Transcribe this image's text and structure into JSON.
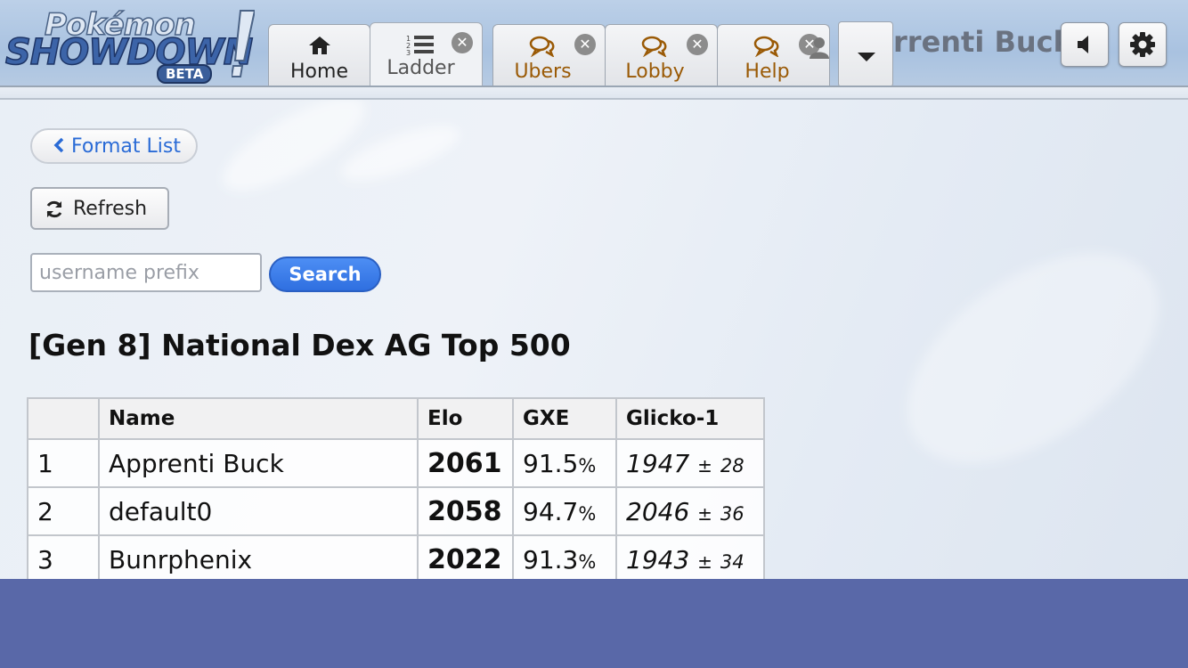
{
  "logo": {
    "line1": "Pokémon",
    "line2": "SHOWDOWN",
    "badge": "BETA"
  },
  "tabs": [
    {
      "label": "Home",
      "icon": "home-icon"
    },
    {
      "label": "Ladder",
      "icon": "list-icon"
    },
    {
      "label": "Ubers",
      "icon": "chat-icon"
    },
    {
      "label": "Lobby",
      "icon": "chat-icon"
    },
    {
      "label": "Help",
      "icon": "chat-icon"
    }
  ],
  "header": {
    "username": "Apprenti Buck",
    "username_visible": "rrenti Buck"
  },
  "main": {
    "format_list_label": "Format List",
    "refresh_label": "Refresh",
    "search_placeholder": "username prefix",
    "search_label": "Search",
    "title": "[Gen 8] National Dex AG Top 500"
  },
  "table": {
    "headers": [
      "",
      "Name",
      "Elo",
      "GXE",
      "Glicko-1"
    ],
    "rows": [
      {
        "rank": "1",
        "name": "Apprenti Buck",
        "elo": "2061",
        "gxe": "91.5",
        "glicko": "1947",
        "dev": "28"
      },
      {
        "rank": "2",
        "name": "default0",
        "elo": "2058",
        "gxe": "94.7",
        "glicko": "2046",
        "dev": "36"
      },
      {
        "rank": "3",
        "name": "Bunrphenix",
        "elo": "2022",
        "gxe": "91.3",
        "glicko": "1943",
        "dev": "34"
      }
    ]
  },
  "colors": {
    "accent": "#2f6fe0",
    "room_tab_text": "#9a5a06",
    "footer": "#5968a8"
  }
}
